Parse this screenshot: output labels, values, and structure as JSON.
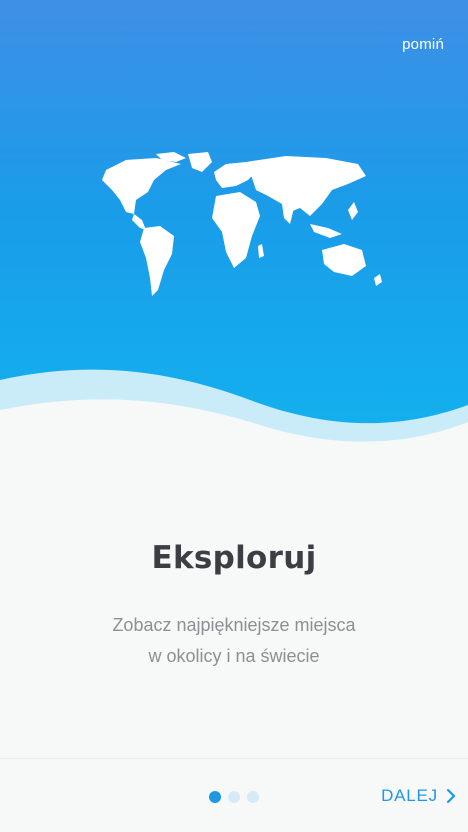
{
  "header": {
    "skip_label": "pomiń"
  },
  "onboarding": {
    "title": "Eksploruj",
    "subtitle_line1": "Zobacz najpiękniejsze miejsca",
    "subtitle_line2": "w okolicy i na świecie"
  },
  "pager": {
    "total_pages": 3,
    "active_page": 1
  },
  "footer": {
    "next_label": "DALEJ"
  },
  "colors": {
    "accent": "#2197e3",
    "hero_top": "#3f8fe6",
    "hero_bottom": "#12b3ee"
  },
  "icons": {
    "map": "world-map-icon",
    "next": "chevron-right-icon"
  }
}
